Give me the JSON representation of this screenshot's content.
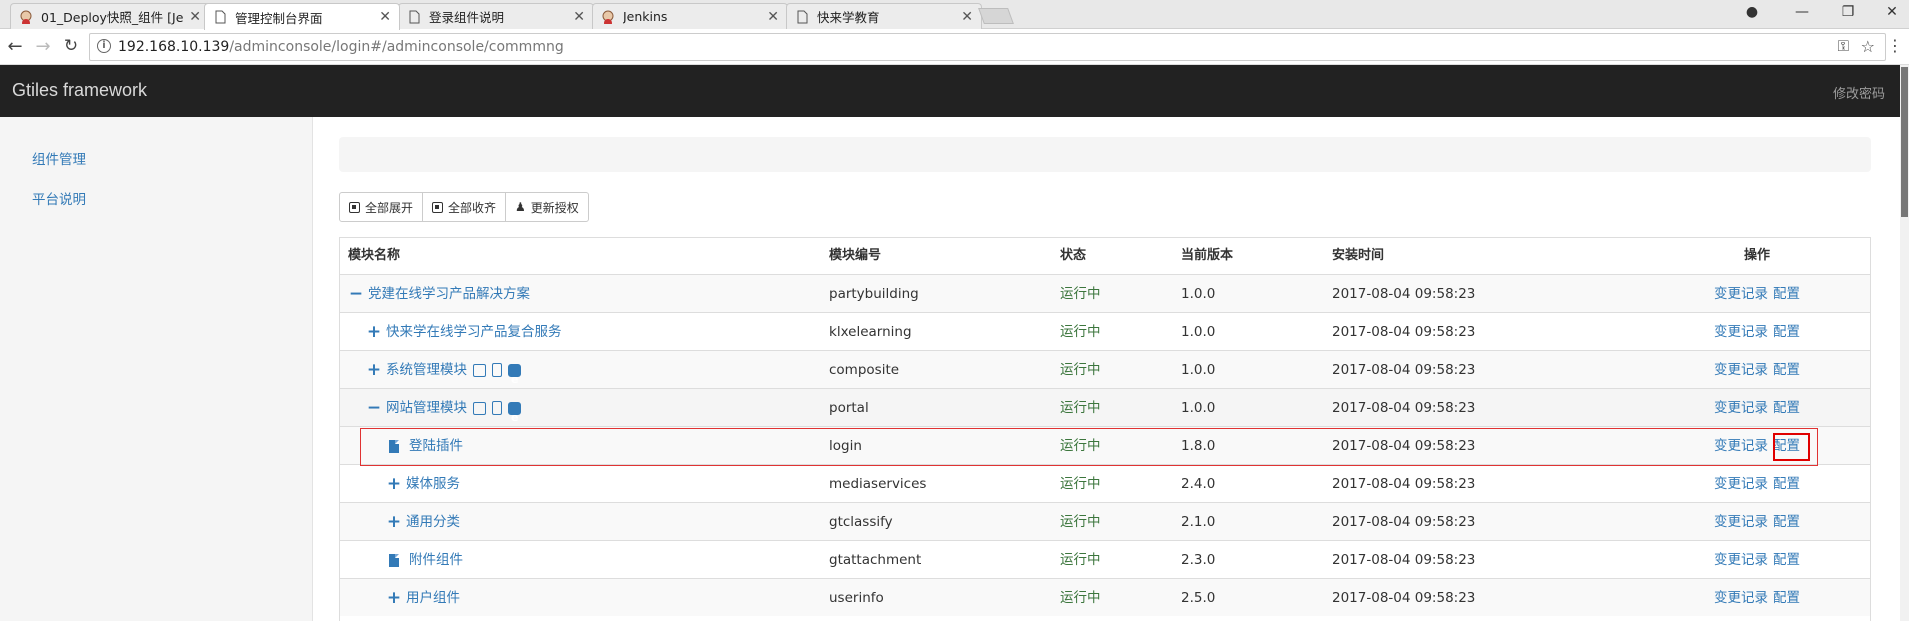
{
  "browser": {
    "tabs": [
      {
        "title": "01_Deploy快照_组件 [Je",
        "icon": "jenkins-icon",
        "active": false
      },
      {
        "title": "管理控制台界面",
        "icon": "page-icon",
        "active": true
      },
      {
        "title": "登录组件说明",
        "icon": "page-icon",
        "active": false
      },
      {
        "title": "Jenkins",
        "icon": "jenkins-icon",
        "active": false
      },
      {
        "title": "快来学教育",
        "icon": "page-icon",
        "active": false
      }
    ],
    "url_host": "192.168.10.139",
    "url_path": "/adminconsole/login#/adminconsole/commmng"
  },
  "app": {
    "brand": "Gtiles framework",
    "change_password": "修改密码"
  },
  "sidebar": {
    "items": [
      {
        "label": "组件管理"
      },
      {
        "label": "平台说明"
      }
    ]
  },
  "toolbar": {
    "expand_all": "全部展开",
    "collapse_all": "全部收齐",
    "update_license": "更新授权"
  },
  "table": {
    "columns": [
      "模块名称",
      "模块编号",
      "状态",
      "当前版本",
      "安装时间",
      "操作"
    ],
    "rows": [
      {
        "name": "党建在线学习产品解决方案",
        "code": "partybuilding",
        "status": "运行中",
        "version": "1.0.0",
        "installed": "2017-08-04 09:58:23",
        "toggle": "−",
        "indent": 0,
        "type": "node",
        "icons": false
      },
      {
        "name": "快来学在线学习产品复合服务",
        "code": "klxelearning",
        "status": "运行中",
        "version": "1.0.0",
        "installed": "2017-08-04 09:58:23",
        "toggle": "+",
        "indent": 1,
        "type": "node",
        "icons": false
      },
      {
        "name": "系统管理模块",
        "code": "composite",
        "status": "运行中",
        "version": "1.0.0",
        "installed": "2017-08-04 09:58:23",
        "toggle": "+",
        "indent": 1,
        "type": "node",
        "icons": true
      },
      {
        "name": "网站管理模块",
        "code": "portal",
        "status": "运行中",
        "version": "1.0.0",
        "installed": "2017-08-04 09:58:23",
        "toggle": "−",
        "indent": 1,
        "type": "node",
        "icons": true
      },
      {
        "name": "登陆插件",
        "code": "login",
        "status": "运行中",
        "version": "1.8.0",
        "installed": "2017-08-04 09:58:23",
        "toggle": "",
        "indent": 2,
        "type": "leaf",
        "icons": false
      },
      {
        "name": "媒体服务",
        "code": "mediaservices",
        "status": "运行中",
        "version": "2.4.0",
        "installed": "2017-08-04 09:58:23",
        "toggle": "+",
        "indent": 2,
        "type": "node",
        "icons": false
      },
      {
        "name": "通用分类",
        "code": "gtclassify",
        "status": "运行中",
        "version": "2.1.0",
        "installed": "2017-08-04 09:58:23",
        "toggle": "+",
        "indent": 2,
        "type": "node",
        "icons": false
      },
      {
        "name": "附件组件",
        "code": "gtattachment",
        "status": "运行中",
        "version": "2.3.0",
        "installed": "2017-08-04 09:58:23",
        "toggle": "",
        "indent": 2,
        "type": "leaf",
        "icons": false
      },
      {
        "name": "用户组件",
        "code": "userinfo",
        "status": "运行中",
        "version": "2.5.0",
        "installed": "2017-08-04 09:58:23",
        "toggle": "+",
        "indent": 2,
        "type": "node",
        "icons": false
      }
    ],
    "action_history": "变更记录",
    "action_config": "配置"
  }
}
